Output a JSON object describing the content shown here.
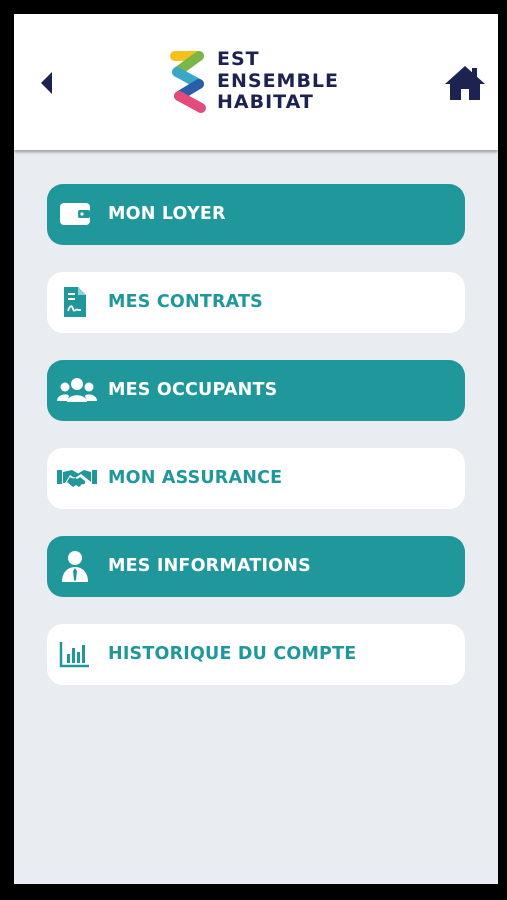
{
  "header": {
    "logo_lines": [
      "EST",
      "ENSEMBLE",
      "HABITAT"
    ],
    "back_icon": "caret-left-icon",
    "home_icon": "home-icon"
  },
  "colors": {
    "accent": "#1f979b",
    "brand_navy": "#1d2350",
    "background": "#e9edf1"
  },
  "menu": {
    "items": [
      {
        "label": "MON LOYER",
        "icon": "wallet-icon",
        "style": "filled"
      },
      {
        "label": "MES CONTRATS",
        "icon": "contract-document-icon",
        "style": "outline"
      },
      {
        "label": "MES OCCUPANTS",
        "icon": "users-group-icon",
        "style": "filled"
      },
      {
        "label": "MON ASSURANCE",
        "icon": "handshake-icon",
        "style": "outline"
      },
      {
        "label": "MES INFORMATIONS",
        "icon": "user-tie-icon",
        "style": "filled"
      },
      {
        "label": "HISTORIQUE DU COMPTE",
        "icon": "bar-chart-icon",
        "style": "outline"
      }
    ]
  }
}
